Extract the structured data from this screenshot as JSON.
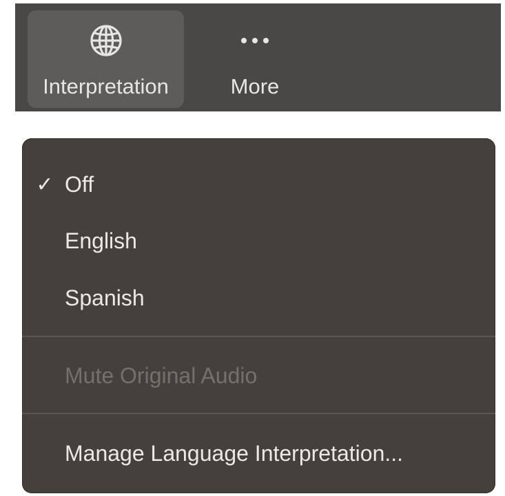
{
  "toolbar": {
    "buttons": [
      {
        "label": "Interpretation",
        "icon": "globe-icon",
        "active": true
      },
      {
        "label": "More",
        "icon": "ellipsis-icon",
        "active": false
      }
    ],
    "background_color": "#4a4846",
    "active_color": "#5e5c5a"
  },
  "menu": {
    "background_color": "#45403c",
    "languages": [
      {
        "label": "Off",
        "checked": true,
        "check_glyph": "✓"
      },
      {
        "label": "English",
        "checked": false
      },
      {
        "label": "Spanish",
        "checked": false
      }
    ],
    "mute_original_audio": {
      "label": "Mute Original Audio",
      "enabled": false
    },
    "manage": {
      "label": "Manage Language Interpretation..."
    }
  }
}
